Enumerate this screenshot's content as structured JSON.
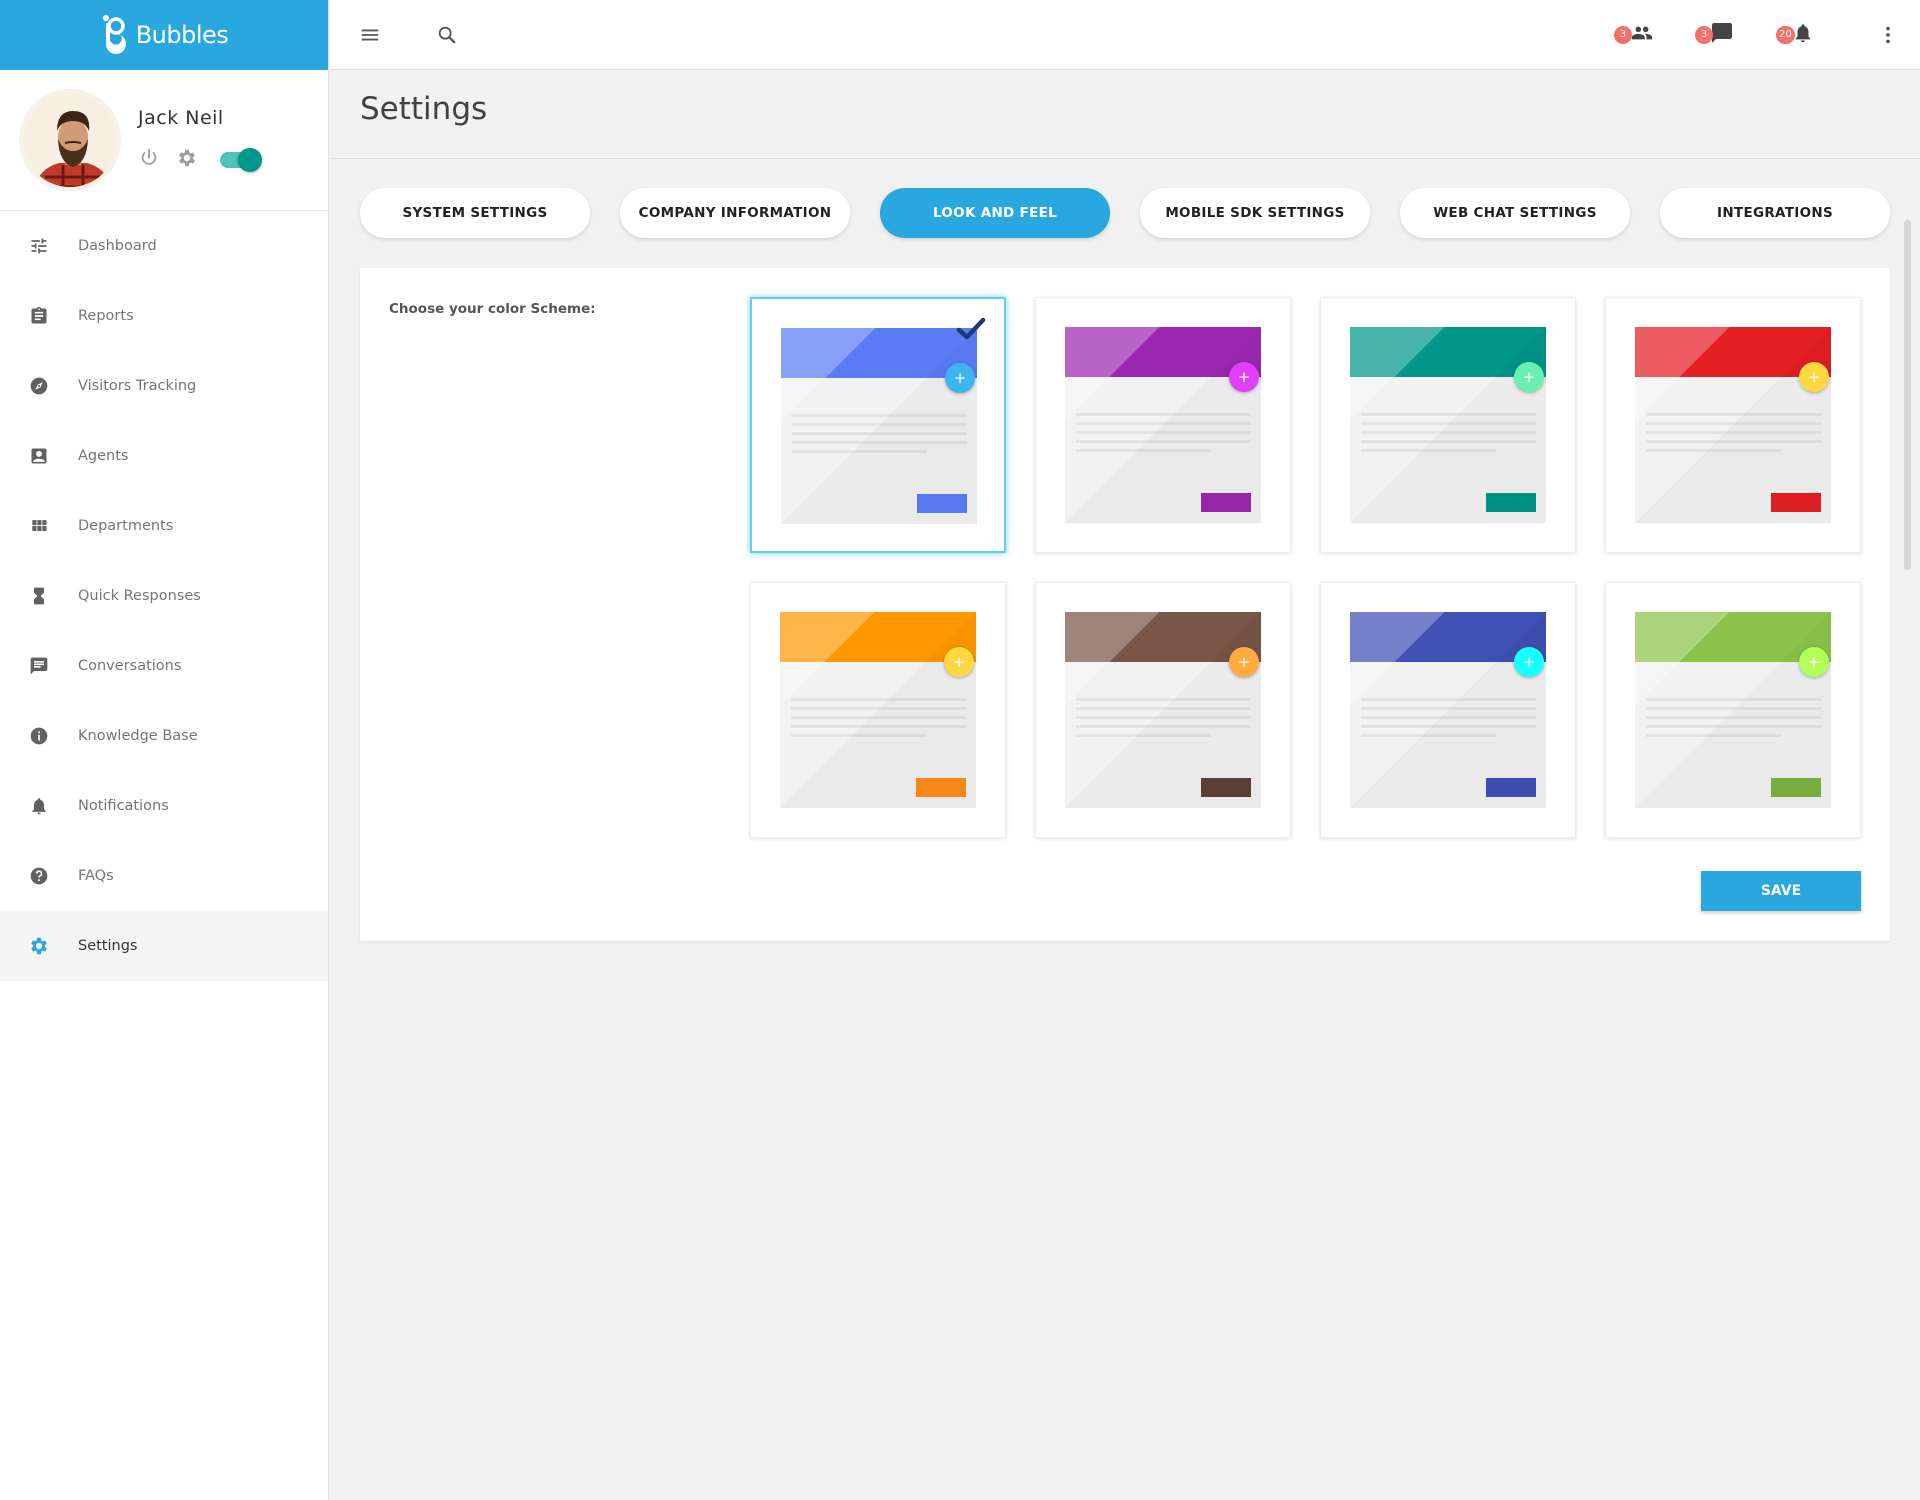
{
  "brand": {
    "name": "Bubbles"
  },
  "profile": {
    "name": "Jack Neil"
  },
  "sidebar": {
    "items": [
      {
        "label": "Dashboard",
        "icon": "tune-icon"
      },
      {
        "label": "Reports",
        "icon": "clipboard-icon"
      },
      {
        "label": "Visitors Tracking",
        "icon": "compass-icon"
      },
      {
        "label": "Agents",
        "icon": "contact-icon"
      },
      {
        "label": "Departments",
        "icon": "grid-icon"
      },
      {
        "label": "Quick Responses",
        "icon": "hourglass-icon"
      },
      {
        "label": "Conversations",
        "icon": "chat-icon"
      },
      {
        "label": "Knowledge Base",
        "icon": "info-icon"
      },
      {
        "label": "Notifications",
        "icon": "bell-icon"
      },
      {
        "label": "FAQs",
        "icon": "help-icon"
      },
      {
        "label": "Settings",
        "icon": "gear-icon",
        "active": true
      }
    ]
  },
  "topbar": {
    "badges": {
      "people": "3",
      "messages": "3",
      "notifications": "20"
    }
  },
  "page": {
    "title": "Settings"
  },
  "tabs": [
    {
      "label": "SYSTEM SETTINGS"
    },
    {
      "label": "COMPANY INFORMATION"
    },
    {
      "label": "LOOK AND FEEL",
      "active": true
    },
    {
      "label": "MOBILE SDK SETTINGS"
    },
    {
      "label": "WEB CHAT SETTINGS"
    },
    {
      "label": "INTEGRATIONS"
    }
  ],
  "look_and_feel": {
    "label": "Choose your color Scheme:",
    "schemes": [
      {
        "name": "blue",
        "header": "#5a7cf6",
        "fab": "#3fb5f0",
        "button": "#5a7cf6",
        "fab_symbol": "+",
        "selected": true
      },
      {
        "name": "purple",
        "header": "#9c27b0",
        "fab": "#e040fb",
        "button": "#9c27b0",
        "fab_symbol": "+"
      },
      {
        "name": "teal",
        "header": "#009688",
        "fab": "#69f0ae",
        "button": "#009688",
        "fab_symbol": "+"
      },
      {
        "name": "red",
        "header": "#e31e24",
        "fab": "#ffd740",
        "button": "#e31e24",
        "fab_symbol": "+"
      },
      {
        "name": "orange",
        "header": "#ff9800",
        "fab": "#ffd740",
        "button": "#ff8a1a",
        "fab_symbol": "+"
      },
      {
        "name": "brown",
        "header": "#795548",
        "fab": "#ffab40",
        "button": "#5d4037",
        "fab_symbol": "+"
      },
      {
        "name": "indigo",
        "header": "#3f51b5",
        "fab": "#18ffff",
        "button": "#3f51b5",
        "fab_symbol": "+"
      },
      {
        "name": "green",
        "header": "#8bc34a",
        "fab": "#b2ff59",
        "button": "#7cb342",
        "fab_symbol": "+"
      }
    ],
    "save_label": "SAVE"
  },
  "colors": {
    "accent": "#29a8e0",
    "toggle": "#009688",
    "badge": "#f4706b"
  }
}
